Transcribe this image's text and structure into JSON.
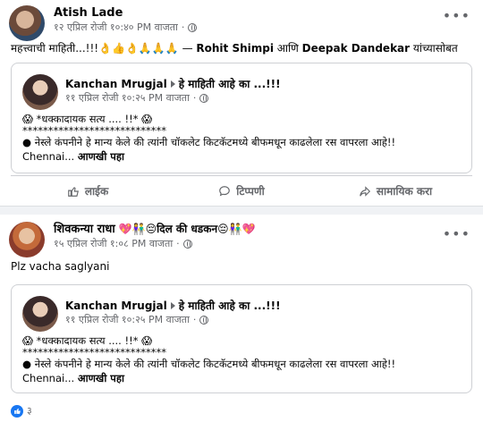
{
  "post1": {
    "author": "Atish Lade",
    "meta": "१२ एप्रिल रोजी १०:४० PM वाजता",
    "text_prefix": "महत्त्वाची माहिती...!!!",
    "text_emoji": "👌👍👌🙏🙏🙏",
    "text_dash": "— ",
    "tag1": "Rohit Shimpi",
    "text_and": " आणि ",
    "tag2": "Deepak Dandekar",
    "text_suffix": " यांच्यासोबत",
    "shared": {
      "author": "Kanchan Mrugjal",
      "group": "हे माहिती आहे का ...!!!",
      "meta": "११ एप्रिल रोजी १०:२५ PM वाजता",
      "line1": "😱 *धक्कादायक सत्य .... !!* 😱",
      "line2": "****************************",
      "line3": "● नेस्ले कंपनीने हे मान्य केले की त्यांनी चॉकलेट किटकॅटमध्ये बीफमधून काढलेला रस वापरला आहे!!",
      "line4": "Chennai...",
      "see_more": "आणखी पहा"
    },
    "actions": {
      "like": "लाईक",
      "comment": "टिप्पणी",
      "share": "सामायिक करा"
    }
  },
  "post2": {
    "author": "शिवकन्या राधा",
    "author_emoji_after": "💖👫😔दिल की धडकन😔👫💖",
    "meta": "१५ एप्रिल रोजी १:०८ PM वाजता",
    "text": "Plz vacha saglyani",
    "shared": {
      "author": "Kanchan Mrugjal",
      "group": "हे माहिती आहे का ...!!!",
      "meta": "११ एप्रिल रोजी १०:२५ PM वाजता",
      "line1": "😱 *धक्कादायक सत्य .... !!* 😱",
      "line2": "****************************",
      "line3": "● नेस्ले कंपनीने हे मान्य केले की त्यांनी चॉकलेट किटकॅटमध्ये बीफमधून काढलेला रस वापरला आहे!!",
      "line4": "Chennai...",
      "see_more": "आणखी पहा"
    },
    "reaction_count": "३"
  },
  "icons": [
    "globe-icon",
    "more-options-icon",
    "like-icon",
    "comment-icon",
    "share-icon"
  ],
  "colors": {
    "accent": "#1877f2",
    "muted": "#65676b",
    "background": "#f0f2f5"
  }
}
